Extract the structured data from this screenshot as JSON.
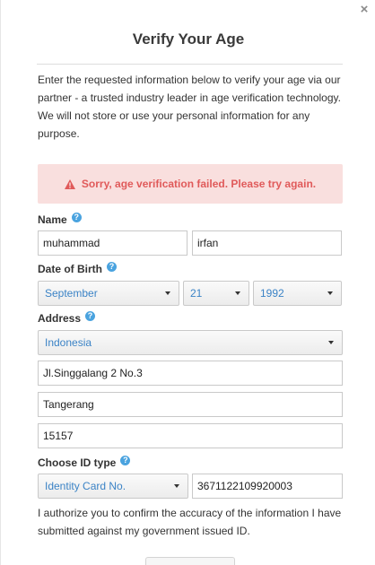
{
  "modal": {
    "title": "Verify Your Age",
    "intro": "Enter the requested information below to verify your age via our partner - a trusted industry leader in age verification technology. We will not store or use your personal information for any purpose.",
    "close_glyph": "×"
  },
  "error": {
    "message": "Sorry, age verification failed. Please try again.",
    "color": "#e05a5a",
    "background": "#f9dfde"
  },
  "name": {
    "label": "Name",
    "first_value": "muhammad",
    "last_value": "irfan"
  },
  "dob": {
    "label": "Date of Birth",
    "month": "September",
    "day": "21",
    "year": "1992"
  },
  "address": {
    "label": "Address",
    "country": "Indonesia",
    "street": "Jl.Singgalang 2 No.3",
    "city": "Tangerang",
    "postal": "15157"
  },
  "id": {
    "label": "Choose ID type",
    "type": "Identity Card No.",
    "number": "3671122109920003"
  },
  "consent": "I authorize you to confirm the accuracy of the information I have submitted against my government issued ID.",
  "help_glyph": "?",
  "colors": {
    "link_blue": "#3b83c6",
    "help_blue": "#4aa3df"
  }
}
